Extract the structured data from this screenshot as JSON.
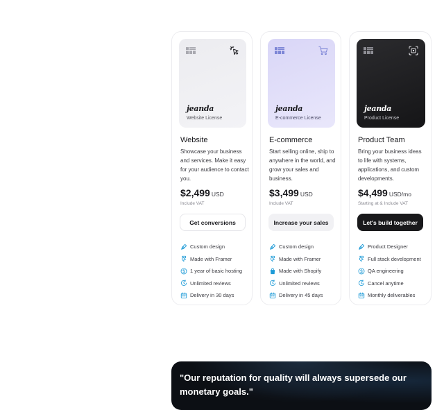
{
  "pricing": {
    "cards": [
      {
        "hero": {
          "brand": "jeanda",
          "license": "Website License",
          "corner_icon": "cursor-click-icon"
        },
        "name": "Website",
        "description": "Showcase your business and services. Make it easy for your audience to contact you.",
        "price": "$2,499",
        "currency": "USD",
        "vat": "Include VAT",
        "cta": "Get conversions",
        "features": [
          {
            "icon": "pen-tool-icon",
            "label": "Custom design"
          },
          {
            "icon": "framer-icon",
            "label": "Made with Framer"
          },
          {
            "icon": "dollar-icon",
            "label": "1 year of basic hosting"
          },
          {
            "icon": "refresh-clock-icon",
            "label": "Unlimited reviews"
          },
          {
            "icon": "calendar-icon",
            "label": "Delivery in 30 days"
          }
        ]
      },
      {
        "hero": {
          "brand": "jeanda",
          "license": "E-commerce License",
          "corner_icon": "cart-icon"
        },
        "name": "E-commerce",
        "description": "Start selling online, ship to anywhere in the world, and grow your sales and business.",
        "price": "$3,499",
        "currency": "USD",
        "vat": "Include VAT",
        "cta": "Increase your sales",
        "features": [
          {
            "icon": "pen-tool-icon",
            "label": "Custom design"
          },
          {
            "icon": "framer-icon",
            "label": "Made with Framer"
          },
          {
            "icon": "shopify-icon",
            "label": "Made with Shopify"
          },
          {
            "icon": "refresh-clock-icon",
            "label": "Unlimited reviews"
          },
          {
            "icon": "calendar-icon",
            "label": "Delivery in 45 days"
          }
        ]
      },
      {
        "hero": {
          "brand": "jeanda",
          "license": "Product License",
          "corner_icon": "target-icon"
        },
        "name": "Product Team",
        "description": "Bring your business ideas to life with systems, applications, and custom developments.",
        "price": "$4,499",
        "currency": "USD/mo",
        "vat": "Starting at & Include VAT",
        "cta": "Let's build together",
        "features": [
          {
            "icon": "pen-tool-icon",
            "label": "Product Designer"
          },
          {
            "icon": "framer-icon",
            "label": "Full stack development"
          },
          {
            "icon": "dollar-icon",
            "label": "QA engineering"
          },
          {
            "icon": "refresh-clock-icon",
            "label": "Cancel anytime"
          },
          {
            "icon": "calendar-icon",
            "label": "Monthly deliverables"
          }
        ]
      }
    ]
  },
  "testimonial": {
    "quote": "\"Our reputation for quality will always supersede our monetary goals.\""
  },
  "colors": {
    "accent_icon": "#1e9bd7",
    "cta_dark": "#19191b",
    "hero_ecommerce": "#d9d6f7",
    "hero_product": "#151517"
  }
}
